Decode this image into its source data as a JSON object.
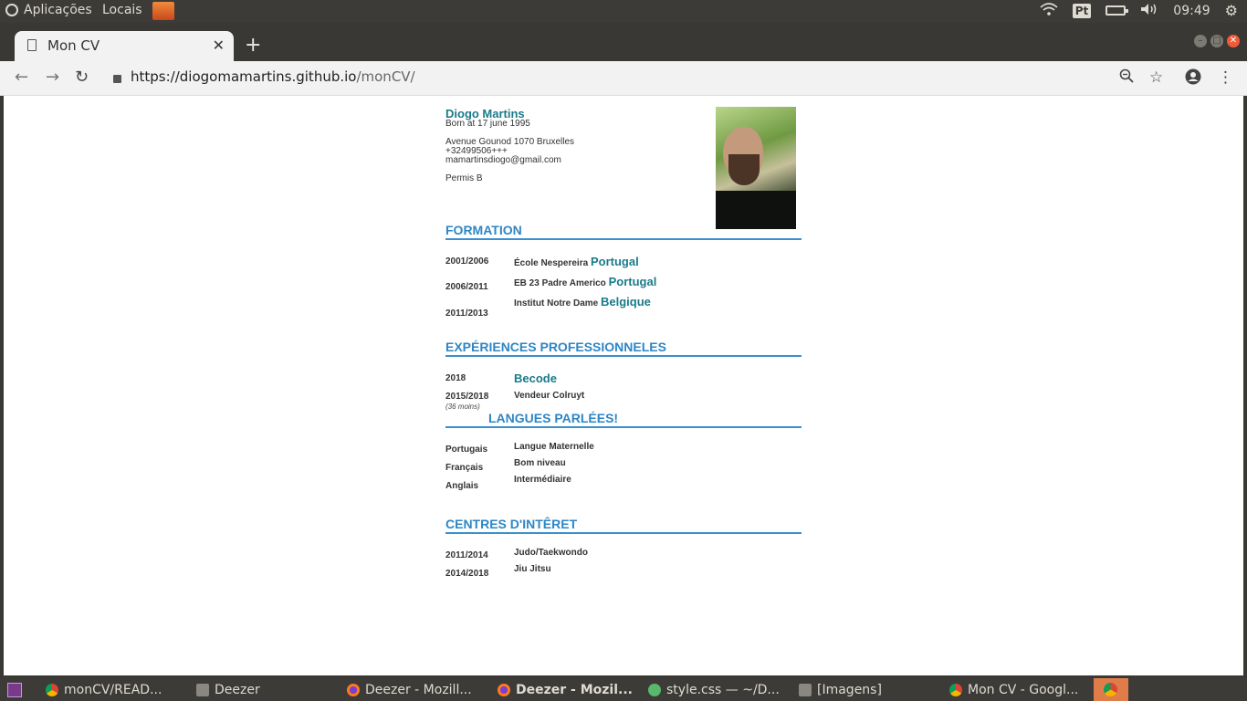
{
  "system_panel": {
    "apps_label": "Aplicações",
    "places_label": "Locais",
    "keyboard_layout": "Pt",
    "clock": "09:49"
  },
  "browser": {
    "tab_title": "Mon CV",
    "url_host": "https://diogomamartins.github.io",
    "url_path": "/monCV/"
  },
  "cv": {
    "name": "Diogo Martins",
    "born": "Born at 17 june 1995",
    "address": "Avenue Gounod 1070 Bruxelles",
    "phone": "+32499506+++",
    "email": "mamartinsdiogo@gmail.com",
    "license": "Permis B",
    "formation": {
      "title": "FORMATION",
      "years": [
        "2001/2006",
        "2006/2011",
        "2011/2013"
      ],
      "schools": [
        {
          "name": "École Nespereira",
          "country": "Portugal"
        },
        {
          "name": "EB 23 Padre Americo",
          "country": "Portugal"
        },
        {
          "name": "Institut Notre Dame",
          "country": "Belgique"
        }
      ]
    },
    "experience": {
      "title": "EXPÉRIENCES PROFESSIONNELES",
      "items": [
        {
          "year": "2018",
          "desc": "Becode"
        },
        {
          "year": "2015/2018",
          "desc": "Vendeur Colruyt",
          "note": "(36 moins)"
        }
      ]
    },
    "languages": {
      "title": "LANGUES PARLÉES!",
      "names": [
        "Portugais",
        "Français",
        "Anglais"
      ],
      "levels": [
        "Langue Maternelle",
        "Bom niveau",
        "Intermédiaire"
      ]
    },
    "interests": {
      "title": "CENTRES D'INTÊRET",
      "years": [
        "2011/2014",
        "2014/2018"
      ],
      "activities": [
        "Judo/Taekwondo",
        "Jiu Jitsu"
      ]
    }
  },
  "taskbar": [
    {
      "label": "monCV/READ..."
    },
    {
      "label": "Deezer"
    },
    {
      "label": "Deezer - Mozill..."
    },
    {
      "label": "Deezer - Mozil..."
    },
    {
      "label": "style.css — ~/D..."
    },
    {
      "label": "[Imagens]"
    },
    {
      "label": "Mon CV - Googl..."
    }
  ]
}
